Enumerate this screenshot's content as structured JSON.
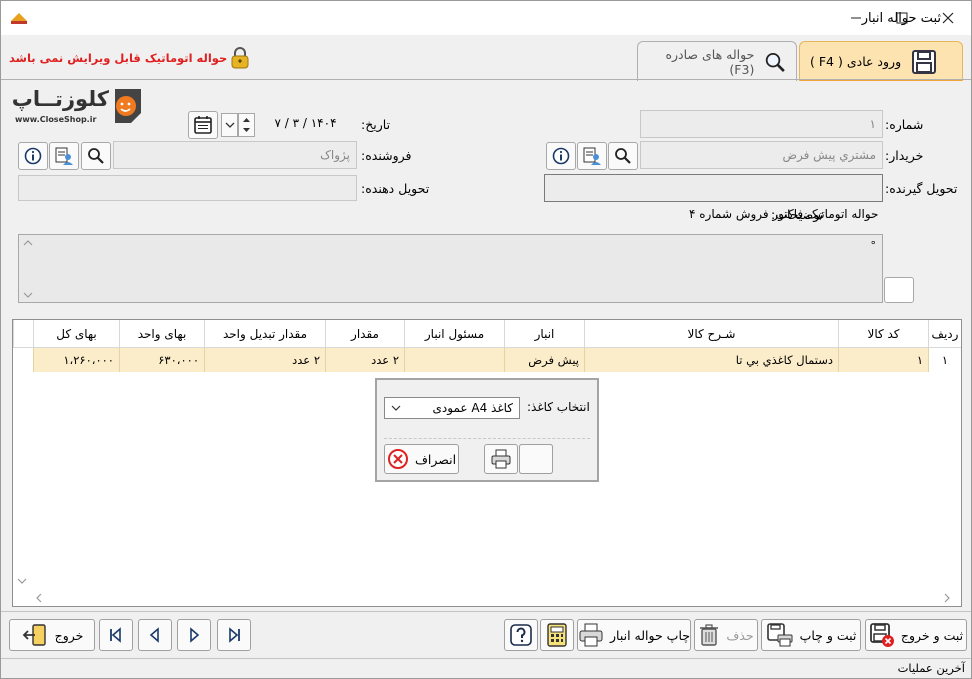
{
  "window": {
    "title": "ثبت حواله انبار"
  },
  "lock_notice": "حواله اتوماتیک قابل ویرایش نمی باشد",
  "tabs": [
    {
      "label": "ورود عادی ( F4 )",
      "active": true,
      "icon": "save-icon"
    },
    {
      "label": "حواله های صادره (F3)",
      "active": false,
      "icon": "search-icon"
    }
  ],
  "logo": {
    "brand": "کلوزتــاپ",
    "url": "www.CloseShop.ir"
  },
  "form": {
    "number_label": "شماره:",
    "number_value": "۱",
    "date_label": "تاریخ:",
    "date_value": "۱۴۰۴ / ۳ / ۷",
    "buyer_label": "خریدار:",
    "buyer_value": "مشتري پيش فرض",
    "seller_label": "فروشنده:",
    "seller_value": "پژواک",
    "receiver_label": "تحویل گیرنده:",
    "deliverer_label": "تحویل دهنده:",
    "notes_label": "توضیحات:",
    "notes_value": "حواله اتوماتیک فاکتور فروش شماره ۴",
    "memo_text": "°"
  },
  "table": {
    "columns": [
      "ردیف",
      "کد کالا",
      "شـرح کالا",
      "انبار",
      "مسئول انبار",
      "مقدار",
      "مقدار تبدیل واحد",
      "بهای واحد",
      "بهای کل"
    ],
    "rows": [
      {
        "row": "۱",
        "code": "۱",
        "desc": "دستمال کاغذي بي تا",
        "warehouse": "پیش فرض",
        "keeper": "",
        "qty": "۲ عدد",
        "conv_qty": "۲ عدد",
        "unit_price": "۶۳۰،۰۰۰",
        "total": "۱،۲۶۰،۰۰۰"
      }
    ]
  },
  "dialog": {
    "paper_label": "انتخاب کاغذ:",
    "paper_value": "کاغذ A4 عمودی",
    "cancel_label": "انصراف"
  },
  "toolbar": {
    "save_exit": "ثبت و خروج",
    "save_print": "ثبت و چاپ",
    "delete": "حذف",
    "print_voucher": "چاپ حواله انبار",
    "exit": "خروج"
  },
  "status": {
    "last_ops": "آخرین عملیات"
  },
  "colors": {
    "tab_active": "#fde3b0",
    "row_highlight": "#fbedc9",
    "notice_red": "#e02020",
    "lock_gold": "#d4a017"
  }
}
